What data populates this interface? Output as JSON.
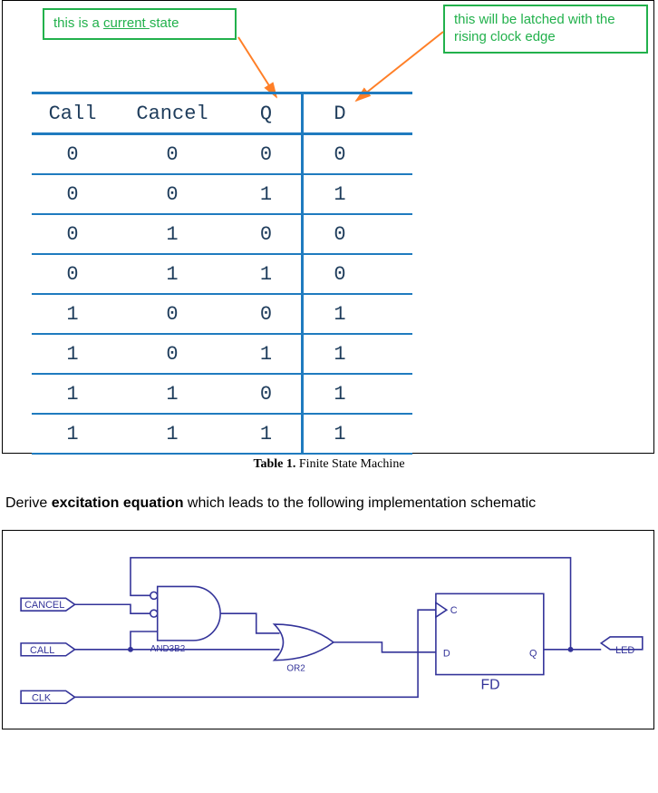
{
  "callouts": {
    "left": "this is a <u>current </u>state",
    "right": "this will be latched with the rising clock edge"
  },
  "truth_table": {
    "headers": [
      "Call",
      "Cancel",
      "Q",
      "D"
    ],
    "rows": [
      [
        "0",
        "0",
        "0",
        "0"
      ],
      [
        "0",
        "0",
        "1",
        "1"
      ],
      [
        "0",
        "1",
        "0",
        "0"
      ],
      [
        "0",
        "1",
        "1",
        "0"
      ],
      [
        "1",
        "0",
        "0",
        "1"
      ],
      [
        "1",
        "0",
        "1",
        "1"
      ],
      [
        "1",
        "1",
        "0",
        "1"
      ],
      [
        "1",
        "1",
        "1",
        "1"
      ]
    ]
  },
  "caption": {
    "label": "Table 1.",
    "text": "Finite State Machine"
  },
  "body": {
    "pre": "Derive ",
    "bold": "excitation equation",
    "post": " which leads to the following implementation schematic"
  },
  "schematic": {
    "inputs": [
      "CANCEL",
      "CALL",
      "CLK"
    ],
    "outputs": [
      "LED"
    ],
    "gates": {
      "and": "AND3B2",
      "or": "OR2",
      "ff": "FD"
    },
    "ff_pins": {
      "clk": "C",
      "d": "D",
      "q": "Q"
    }
  }
}
